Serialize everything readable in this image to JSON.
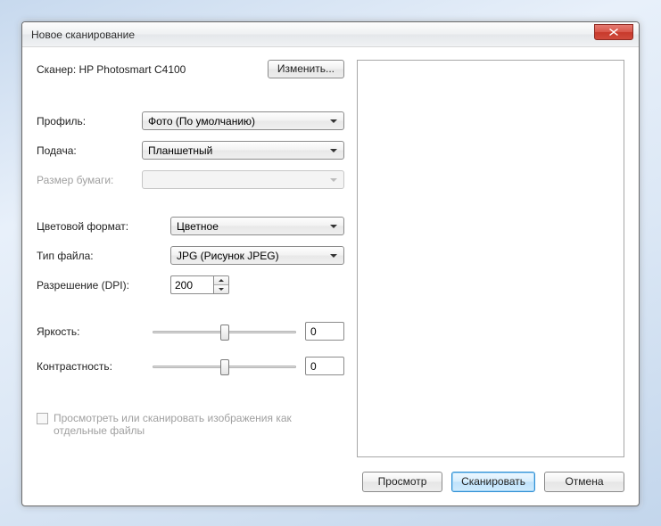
{
  "window": {
    "title": "Новое сканирование"
  },
  "scanner": {
    "label": "Сканер: HP Photosmart C4100",
    "change_btn": "Изменить..."
  },
  "profile": {
    "label": "Профиль:",
    "value": "Фото (По умолчанию)"
  },
  "source": {
    "label": "Подача:",
    "value": "Планшетный"
  },
  "paper": {
    "label": "Размер бумаги:",
    "value": ""
  },
  "color": {
    "label": "Цветовой формат:",
    "value": "Цветное"
  },
  "filetype": {
    "label": "Тип файла:",
    "value": "JPG (Рисунок JPEG)"
  },
  "resolution": {
    "label": "Разрешение (DPI):",
    "value": "200"
  },
  "brightness": {
    "label": "Яркость:",
    "value": "0"
  },
  "contrast": {
    "label": "Контрастность:",
    "value": "0"
  },
  "separate": {
    "label": "Просмотреть или сканировать изображения как отдельные файлы"
  },
  "footer": {
    "preview": "Просмотр",
    "scan": "Сканировать",
    "cancel": "Отмена"
  }
}
